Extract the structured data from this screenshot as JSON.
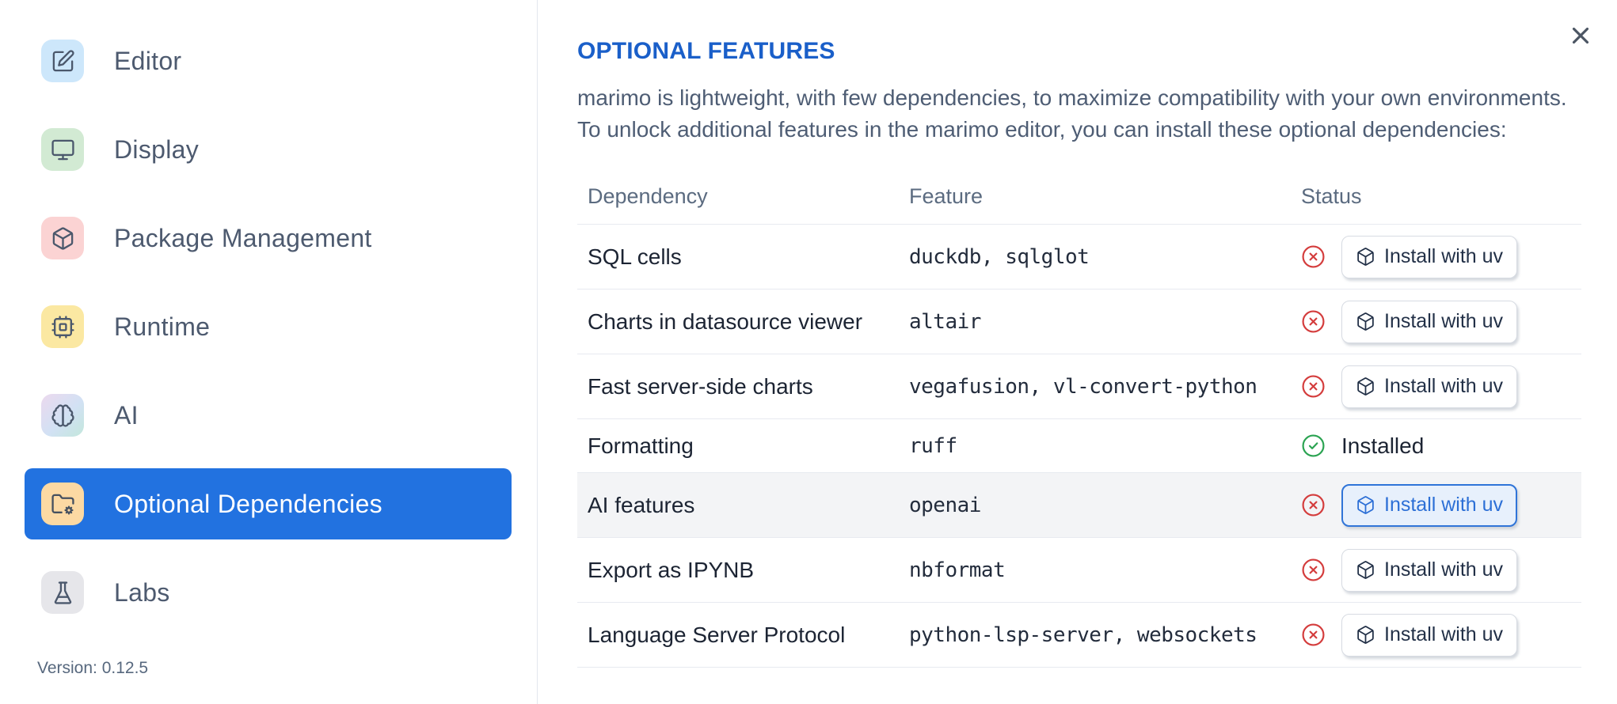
{
  "dialog": {
    "title": "OPTIONAL FEATURES",
    "description_lines": [
      "marimo is lightweight, with few dependencies, to maximize compatibility with your own environments.",
      "To unlock additional features in the marimo editor, you can install these optional dependencies:"
    ],
    "close_icon": "x-icon"
  },
  "sidebar": {
    "items": [
      {
        "label": "Editor",
        "icon": "square-pen-icon",
        "tile_color": "#cde7fb",
        "selected": false
      },
      {
        "label": "Display",
        "icon": "monitor-icon",
        "tile_color": "#d2ead3",
        "selected": false
      },
      {
        "label": "Package Management",
        "icon": "package-box-icon",
        "tile_color": "#fbd3d3",
        "selected": false
      },
      {
        "label": "Runtime",
        "icon": "cpu-icon",
        "tile_color": "#fbe8a2",
        "selected": false
      },
      {
        "label": "AI",
        "icon": "brain-icon",
        "tile_color": "gradient(#ecd9ee,#c3e7dc)",
        "selected": false
      },
      {
        "label": "Optional Dependencies",
        "icon": "folder-cog-icon",
        "tile_color": "#fcd9a3",
        "selected": true
      },
      {
        "label": "Labs",
        "icon": "flask-icon",
        "tile_color": "#e6e6ea",
        "selected": false
      }
    ],
    "version": "Version: 0.12.5"
  },
  "table": {
    "headers": {
      "dependency": "Dependency",
      "feature": "Feature",
      "status": "Status"
    },
    "rows": [
      {
        "dependency": "SQL cells",
        "feature": "duckdb, sqlglot",
        "installed": false,
        "status_icon": "circle-x",
        "action_label": "Install with uv",
        "action_icon": "package-box"
      },
      {
        "dependency": "Charts in datasource viewer",
        "feature": "altair",
        "installed": false,
        "status_icon": "circle-x",
        "action_label": "Install with uv",
        "action_icon": "package-box"
      },
      {
        "dependency": "Fast server-side charts",
        "feature": "vegafusion, vl-convert-python",
        "installed": false,
        "status_icon": "circle-x",
        "action_label": "Install with uv",
        "action_icon": "package-box"
      },
      {
        "dependency": "Formatting",
        "feature": "ruff",
        "installed": true,
        "status_icon": "circle-check",
        "status_label": "Installed"
      },
      {
        "dependency": "AI features",
        "feature": "openai",
        "installed": false,
        "status_icon": "circle-x",
        "action_label": "Install with uv",
        "action_icon": "package-box",
        "highlighted": true,
        "button_focused": true
      },
      {
        "dependency": "Export as IPYNB",
        "feature": "nbformat",
        "installed": false,
        "status_icon": "circle-x",
        "action_label": "Install with uv",
        "action_icon": "package-box"
      },
      {
        "dependency": "Language Server Protocol",
        "feature": "python-lsp-server, websockets",
        "installed": false,
        "status_icon": "circle-x",
        "action_label": "Install with uv",
        "action_icon": "package-box"
      }
    ]
  },
  "colors": {
    "selected_item_blue": "#2272e0",
    "title_blue": "#1a5fc9",
    "focused_button_blue": "#2c6fd6",
    "error_red": "#d43d3d",
    "success_green": "#2ba352",
    "row_highlight": "#f3f4f6"
  }
}
